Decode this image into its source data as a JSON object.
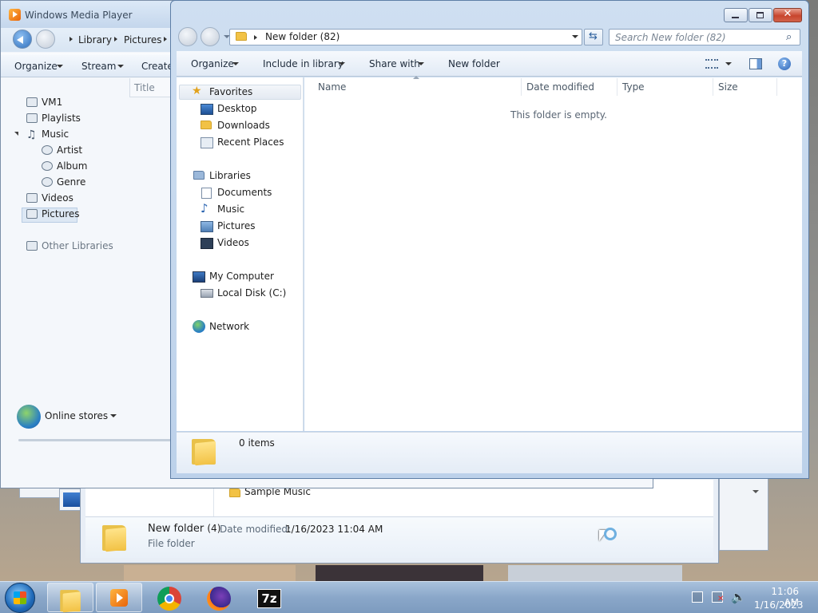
{
  "wmp": {
    "title": "Windows Media Player",
    "breadcrumb": [
      "Library",
      "Pictures"
    ],
    "toolbar": {
      "organize": "Organize",
      "stream": "Stream",
      "create": "Create"
    },
    "column_title": "Title",
    "nav": {
      "vm1": "VM1",
      "playlists": "Playlists",
      "music": "Music",
      "artist": "Artist",
      "album": "Album",
      "genre": "Genre",
      "videos": "Videos",
      "pictures": "Pictures",
      "other_libraries": "Other Libraries"
    },
    "online_stores": "Online stores"
  },
  "back_explorer": {
    "list_item": "Sample Music",
    "details": {
      "name": "New folder",
      "count": "(4)",
      "date_label": "Date modified:",
      "date_value": "1/16/2023 11:04 AM",
      "type": "File folder"
    }
  },
  "explorer": {
    "address": "New folder (82)",
    "search_placeholder": "Search New folder (82)",
    "toolbar": {
      "organize": "Organize",
      "include": "Include in library",
      "share": "Share with",
      "new_folder": "New folder"
    },
    "nav": {
      "favorites": "Favorites",
      "desktop": "Desktop",
      "downloads": "Downloads",
      "recent": "Recent Places",
      "libraries": "Libraries",
      "documents": "Documents",
      "music": "Music",
      "pictures": "Pictures",
      "videos": "Videos",
      "computer": "My Computer",
      "local_disk": "Local Disk (C:)",
      "network": "Network"
    },
    "columns": [
      "Name",
      "Date modified",
      "Type",
      "Size"
    ],
    "empty_message": "This folder is empty.",
    "status": "0 items"
  },
  "taskbar": {
    "apps": [
      "explorer-icon",
      "media-player-icon",
      "chrome-icon",
      "firefox-icon",
      "7zip-icon"
    ],
    "sevenzip_label": "7z",
    "time": "11:06 AM",
    "date": "1/16/2023"
  },
  "colors": {
    "accent": "#2b63b6",
    "taskbar": "#8aa7c9",
    "close_button": "#c8452d"
  }
}
